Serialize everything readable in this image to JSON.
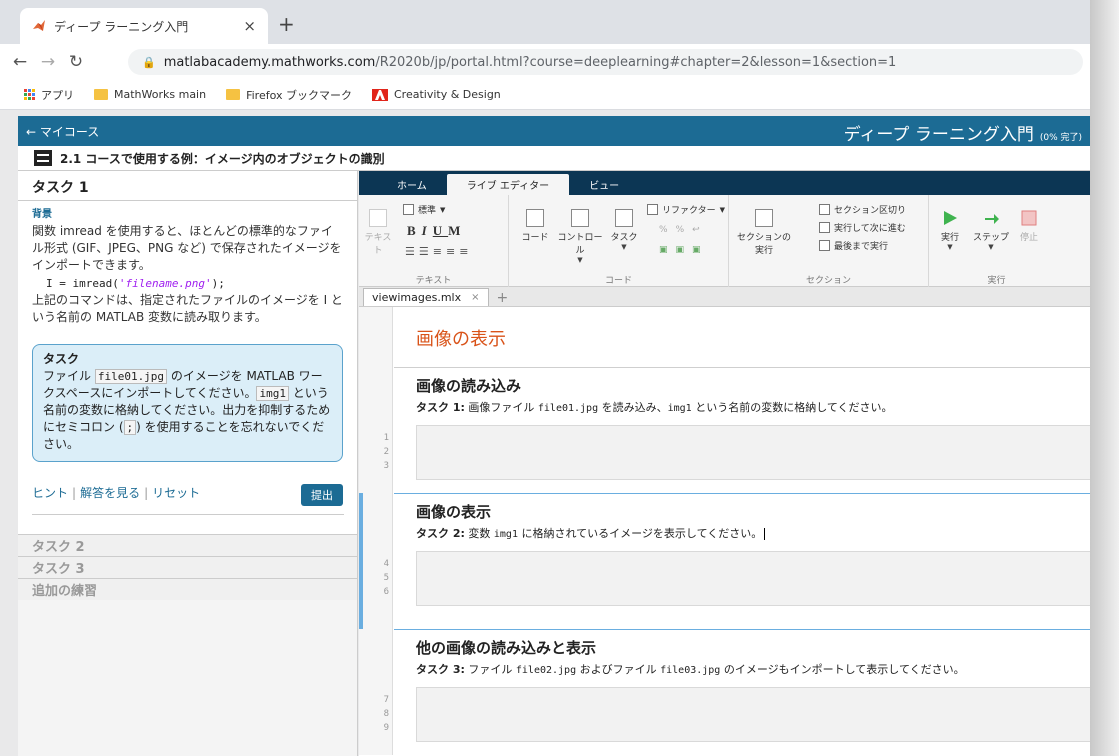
{
  "browser": {
    "tab_title": "ディープ ラーニング入門",
    "url_host": "matlabacademy.mathworks.com",
    "url_path": "/R2020b/jp/portal.html?course=deeplearning#chapter=2&lesson=1&section=1",
    "bookmarks": [
      "アプリ",
      "MathWorks main",
      "Firefox ブックマーク",
      "Creativity & Design"
    ]
  },
  "course": {
    "back_label": "← マイコース",
    "title": "ディープ ラーニング入門",
    "progress": "(0% 完了)",
    "lesson_title": "2.1 コースで使用する例：イメージ内のオブジェクトの識別"
  },
  "left": {
    "task_heading": "タスク 1",
    "background_label": "背景",
    "para1": "関数 imread を使用すると、ほとんどの標準的なファイル形式 (GIF、JPEG、PNG など) で保存されたイメージをインポートできます。",
    "code_prefix": "I = imread(",
    "code_string": "'filename.png'",
    "code_suffix": ");",
    "para2": "上記のコマンドは、指定されたファイルのイメージを I という名前の MATLAB 変数に読み取ります。",
    "task_box": {
      "title": "タスク",
      "text1": "ファイル ",
      "file": "file01.jpg",
      "text2": " のイメージを MATLAB ワークスペースにインポートしてください。",
      "var": "img1",
      "text3": " という名前の変数に格納してください。出力を抑制するためにセミコロン (",
      "semi": ";",
      "text4": ") を使用することを忘れないでください。"
    },
    "links": [
      "ヒント",
      "解答を見る",
      "リセット"
    ],
    "submit_label": "提出",
    "collapsed_tasks": [
      "タスク 2",
      "タスク 3",
      "追加の練習"
    ]
  },
  "editor": {
    "tabs": [
      "ホーム",
      "ライブ エディター",
      "ビュー"
    ],
    "active_tab": "ライブ エディター",
    "ribbon": {
      "text_label": "テキスト",
      "style_label": "標準",
      "code_label": "コード",
      "control_label": "コントロール",
      "task_label": "タスク",
      "refactor_label": "リファクター",
      "run_section_label": "セクションの実行",
      "section_break_label": "セクション区切り",
      "run_advance_label": "実行して次に進む",
      "run_to_end_label": "最後まで実行",
      "run_label": "実行",
      "step_label": "ステップ",
      "stop_label": "停止",
      "group_text": "テキスト",
      "group_code": "コード",
      "group_section": "セクション",
      "group_run": "実行"
    },
    "file_tab": "viewimages.mlx",
    "doc_title": "画像の表示",
    "sections": [
      {
        "heading": "画像の読み込み",
        "task_label": "タスク 1:",
        "text_a": " 画像ファイル ",
        "code_a": "file01.jpg",
        "text_b": " を読み込み、",
        "code_b": "img1",
        "text_c": " という名前の変数に格納してください。",
        "lines": [
          "1",
          "2",
          "3"
        ]
      },
      {
        "heading": "画像の表示",
        "task_label": "タスク 2:",
        "text_a": " 変数 ",
        "code_a": "img1",
        "text_b": " に格納されているイメージを表示してください。",
        "code_b": "",
        "text_c": "",
        "lines": [
          "4",
          "5",
          "6"
        ]
      },
      {
        "heading": "他の画像の読み込みと表示",
        "task_label": "タスク 3:",
        "text_a": " ファイル ",
        "code_a": "file02.jpg",
        "text_b": " およびファイル ",
        "code_b": "file03.jpg",
        "text_c": " のイメージもインポートして表示してください。",
        "lines": [
          "7",
          "8",
          "9"
        ]
      }
    ]
  },
  "colors": {
    "course_header": "#1c6b94",
    "editor_tabs": "#0c3654",
    "doc_title": "#d95319",
    "task_box": "#dbeef8"
  }
}
